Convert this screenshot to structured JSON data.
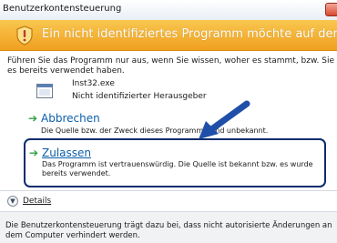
{
  "window": {
    "title": "Benutzerkontensteuerung"
  },
  "banner": {
    "text": "Ein nicht identifiziertes Programm möchte auf den Computer zugreifen",
    "icon": "shield-warning-icon",
    "color": "#f0a020"
  },
  "intro_text": "Führen Sie das Programm nur aus, wenn Sie wissen, woher es stammt, bzw. Sie es bereits verwendet haben.",
  "program": {
    "name": "Inst32.exe",
    "publisher": "Nicht identifizierter Herausgeber",
    "icon": "program-window-icon"
  },
  "options": {
    "cancel": {
      "title": "Abbrechen",
      "description": "Die Quelle bzw. der Zweck dieses Programms sind unbekannt."
    },
    "allow": {
      "title": "Zulassen",
      "description": "Das Programm ist vertrauenswürdig. Die Quelle ist bekannt bzw. es wurde bereits verwendet."
    }
  },
  "details": {
    "label": "Details"
  },
  "footer": {
    "text": "Die Benutzerkontensteuerung trägt dazu bei, dass nicht autorisierte Änderungen an dem Computer verhindert werden."
  },
  "colors": {
    "link_blue": "#0b5ea8",
    "highlight_border": "#0a2c6e",
    "pointer_arrow": "#1f4fa8",
    "green_arrow": "#2ea043"
  }
}
